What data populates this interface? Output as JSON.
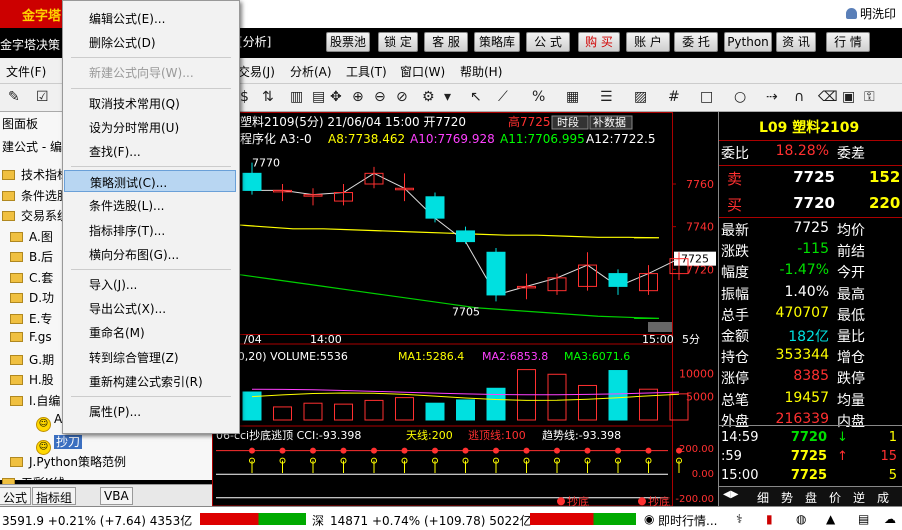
{
  "app": {
    "logo": "金字塔",
    "title": "金字塔决策",
    "title_suffix": "[分析]",
    "user": "明洗印"
  },
  "nav_buttons": [
    "股票池",
    "锁 定",
    "客 服",
    "策略库",
    "公 式",
    "购 买",
    "账 户",
    "委 托",
    "Python",
    "资 讯",
    "行 情"
  ],
  "menubar": {
    "file": "文件(F)",
    "items": [
      "交易(J)",
      "分析(A)",
      "工具(T)",
      "窗口(W)",
      "帮助(H)"
    ],
    "left_fragment": "交易"
  },
  "left_panel": {
    "header": "图面板",
    "sub": "建公式 - 编",
    "tree": [
      {
        "label": "技术指标",
        "type": "folder"
      },
      {
        "label": "条件选股",
        "type": "folder"
      },
      {
        "label": "交易系统",
        "type": "folder"
      },
      {
        "label": "A.图",
        "type": "folder"
      },
      {
        "label": "B.后",
        "type": "folder"
      },
      {
        "label": "C.套",
        "type": "folder"
      },
      {
        "label": "D.功",
        "type": "folder"
      },
      {
        "label": "E.专",
        "type": "folder"
      },
      {
        "label": "F.gs",
        "type": "folder"
      },
      {
        "label": "G.期",
        "type": "folder"
      },
      {
        "label": "H.股",
        "type": "folder"
      },
      {
        "label": "I.自编",
        "type": "folder"
      },
      {
        "label": "A",
        "type": "smile"
      },
      {
        "label": "抄刀",
        "type": "smile-selected"
      },
      {
        "label": "J.Python策略范例",
        "type": "folder"
      },
      {
        "label": "五彩K线",
        "type": "folder"
      }
    ],
    "tabs": [
      "公式",
      "指标组",
      "VBA"
    ]
  },
  "menu": {
    "items": [
      {
        "label": "编辑公式(E)...",
        "state": "normal"
      },
      {
        "label": "删除公式(D)",
        "state": "normal"
      },
      {
        "sep": true
      },
      {
        "label": "新建公式向导(W)...",
        "state": "disabled"
      },
      {
        "sep": true
      },
      {
        "label": "取消技术常用(Q)",
        "state": "normal"
      },
      {
        "label": "设为分时常用(U)",
        "state": "normal"
      },
      {
        "label": "查找(F)...",
        "state": "normal"
      },
      {
        "sep": true
      },
      {
        "label": "策略测试(C)...",
        "state": "selected"
      },
      {
        "label": "条件选股(L)...",
        "state": "normal"
      },
      {
        "label": "指标排序(T)...",
        "state": "normal"
      },
      {
        "label": "横向分布图(G)...",
        "state": "normal"
      },
      {
        "sep": true
      },
      {
        "label": "导入(J)...",
        "state": "normal"
      },
      {
        "label": "导出公式(X)...",
        "state": "normal"
      },
      {
        "label": "重命名(M)",
        "state": "normal"
      },
      {
        "label": "转到综合管理(Z)",
        "state": "normal"
      },
      {
        "label": "重新构建公式索引(R)",
        "state": "normal"
      },
      {
        "sep": true
      },
      {
        "label": "属性(P)...",
        "state": "normal"
      }
    ]
  },
  "chart": {
    "header": "塑料2109(5分) 21/06/04 15:00 开7720",
    "header_high": "高7725",
    "header_btn1": "时段",
    "header_btn2": "补数据",
    "indicator": "程序化 A3:-0",
    "ind_a8": "A8:7738.462",
    "ind_a10": "A10:7769.928",
    "ind_a11": "A11:7706.995",
    "ind_a12": "A12:7722.5",
    "max_label": "7770",
    "min_label": "7705",
    "price_ticks": [
      "7760",
      "7740",
      "7720"
    ],
    "current_price": "7725",
    "time_left": "/04",
    "time_mid": "14:00",
    "time_right": "15:00",
    "period": "5分",
    "vol_header": "(5,10,20) VOLUME:5536",
    "vol_ma1": "MA1:5286.4",
    "vol_ma2": "MA2:6853.8",
    "vol_ma3": "MA3:6071.6",
    "vol_ticks": [
      "10000",
      "5000"
    ],
    "cci_header": "06-cci抄底逃顶 CCI:-93.398",
    "cci_sky": "天线:200",
    "cci_top": "逃顶线:100",
    "cci_trend": "趋势线:-93.398",
    "cci_ticks": [
      "200.00",
      "0.00",
      "-200.00"
    ],
    "cci_mark1": "抄底",
    "cci_mark2": "抄底",
    "candles": [
      {
        "o": 7765,
        "c": 7757,
        "h": 7770,
        "l": 7755
      },
      {
        "o": 7757,
        "c": 7757,
        "h": 7760,
        "l": 7752
      },
      {
        "o": 7755,
        "c": 7755,
        "h": 7758,
        "l": 7750
      },
      {
        "o": 7752,
        "c": 7756,
        "h": 7760,
        "l": 7750
      },
      {
        "o": 7760,
        "c": 7765,
        "h": 7768,
        "l": 7758
      },
      {
        "o": 7758,
        "c": 7758,
        "h": 7765,
        "l": 7752
      },
      {
        "o": 7754,
        "c": 7744,
        "h": 7756,
        "l": 7742
      },
      {
        "o": 7738,
        "c": 7733,
        "h": 7740,
        "l": 7732
      },
      {
        "o": 7728,
        "c": 7708,
        "h": 7730,
        "l": 7705
      },
      {
        "o": 7712,
        "c": 7712,
        "h": 7718,
        "l": 7706
      },
      {
        "o": 7710,
        "c": 7716,
        "h": 7718,
        "l": 7708
      },
      {
        "o": 7712,
        "c": 7722,
        "h": 7728,
        "l": 7710
      },
      {
        "o": 7718,
        "c": 7712,
        "h": 7720,
        "l": 7708
      },
      {
        "o": 7710,
        "c": 7718,
        "h": 7722,
        "l": 7708
      },
      {
        "o": 7718,
        "c": 7725,
        "h": 7728,
        "l": 7715
      }
    ],
    "volumes": [
      6000,
      2800,
      3600,
      3400,
      4200,
      4800,
      3600,
      4300,
      6800,
      10800,
      9800,
      7400,
      10600,
      6600,
      5600
    ]
  },
  "quote": {
    "title": "L09 塑料2109",
    "webi_label": "委比",
    "webi": "18.28%",
    "wecha_label": "委差",
    "sell_label": "卖",
    "sell_price": "7725",
    "sell_vol": "152",
    "buy_label": "买",
    "buy_price": "7720",
    "buy_vol": "220",
    "rows": [
      {
        "l1": "最新",
        "v1": "7725",
        "c1": "white",
        "l2": "均价"
      },
      {
        "l1": "涨跌",
        "v1": "-115",
        "c1": "green",
        "l2": "前结"
      },
      {
        "l1": "幅度",
        "v1": "-1.47%",
        "c1": "green",
        "l2": "今开"
      },
      {
        "l1": "振幅",
        "v1": "1.40%",
        "c1": "white",
        "l2": "最高"
      },
      {
        "l1": "总手",
        "v1": "470707",
        "c1": "yellow",
        "l2": "最低"
      },
      {
        "l1": "金额",
        "v1": "182亿",
        "c1": "cyan",
        "l2": "量比"
      },
      {
        "l1": "持仓",
        "v1": "353344",
        "c1": "yellow",
        "l2": "增仓"
      },
      {
        "l1": "涨停",
        "v1": "8385",
        "c1": "red",
        "l2": "跌停"
      },
      {
        "l1": "总笔",
        "v1": "19457",
        "c1": "yellow",
        "l2": "均量"
      },
      {
        "l1": "外盘",
        "v1": "216339",
        "c1": "red",
        "l2": "内盘"
      }
    ],
    "ticks": [
      {
        "t": "14:59",
        "p": "7720",
        "arrow": "↓",
        "v": "1"
      },
      {
        "t": ":59",
        "p": "7725",
        "arrow": "↑",
        "v": "15"
      },
      {
        "t": "15:00",
        "p": "7725",
        "arrow": "",
        "v": "5"
      }
    ],
    "bottom_tabs": [
      "细",
      "势",
      "盘",
      "价",
      "逆",
      "成"
    ]
  },
  "status": {
    "sh_value": "3591.9 +0.21% (+7.64) 4353亿",
    "sz_label": "深",
    "sz_value": "14871 +0.74% (+109.78) 5022亿",
    "info": "即时行情..."
  }
}
